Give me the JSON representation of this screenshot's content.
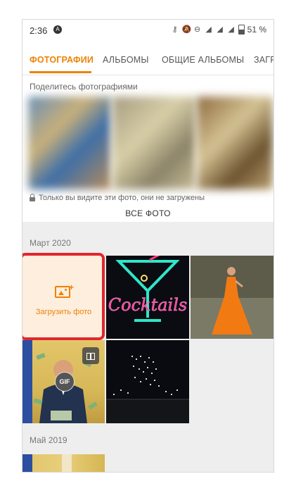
{
  "status_bar": {
    "time": "2:36",
    "battery": "51 %"
  },
  "tabs": [
    {
      "label": "ФОТОГРАФИИ",
      "active": true
    },
    {
      "label": "АЛЬБОМЫ",
      "active": false
    },
    {
      "label": "ОБЩИЕ АЛЬБОМЫ",
      "active": false
    },
    {
      "label": "ЗАГР",
      "active": false
    }
  ],
  "share": {
    "title": "Поделитесь фотографиями",
    "private_notice": "Только вы видите эти фото, они не загружены",
    "all_photos_label": "ВСЕ ФОТО"
  },
  "sections": [
    {
      "month": "Март 2020"
    },
    {
      "month": "Май 2019"
    }
  ],
  "upload": {
    "label": "Загрузить фото"
  },
  "grid": {
    "gif_badge": "GIF",
    "neon_text": "Cocktails"
  },
  "colors": {
    "accent": "#ee8208",
    "highlight": "#e0282e"
  }
}
